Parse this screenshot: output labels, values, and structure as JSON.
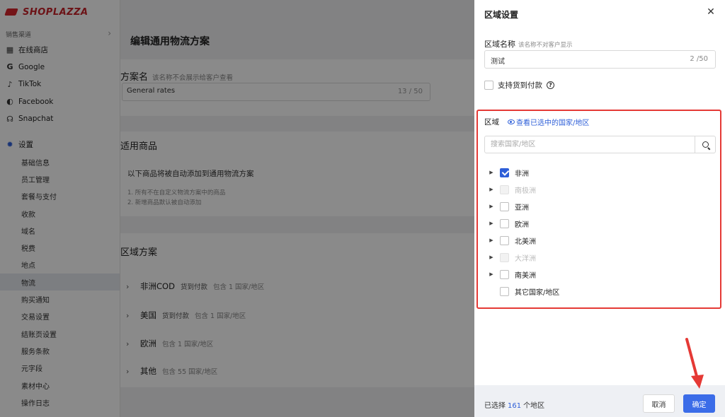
{
  "brand": {
    "logo_text": "SHOPLAZZA"
  },
  "sidebar": {
    "section_label": "销售渠道",
    "channels": [
      {
        "label": "在线商店",
        "icon": "store-icon"
      },
      {
        "label": "Google",
        "icon": "google-icon"
      },
      {
        "label": "TikTok",
        "icon": "tiktok-icon"
      },
      {
        "label": "Facebook",
        "icon": "facebook-icon"
      },
      {
        "label": "Snapchat",
        "icon": "snapchat-icon"
      }
    ],
    "settings_label": "设置",
    "settings_icon": "gear-icon",
    "settings_items": [
      "基础信息",
      "员工管理",
      "套餐与支付",
      "收款",
      "域名",
      "税费",
      "地点",
      "物流",
      "购买通知",
      "交易设置",
      "结账页设置",
      "服务条款",
      "元字段",
      "素材中心",
      "操作日志"
    ],
    "active_item": "物流"
  },
  "main": {
    "title": "编辑通用物流方案",
    "plan_name": {
      "label": "方案名",
      "hint": "该名称不会展示给客户查看",
      "value": "General rates",
      "count": "13 / 50"
    },
    "goods": {
      "title": "适用商品",
      "text": "以下商品将被自动添加到通用物流方案",
      "notes": [
        "1. 所有不在自定义物流方案中的商品",
        "2. 新增商品默认被自动添加"
      ]
    },
    "zones": {
      "title": "区域方案",
      "items": [
        {
          "name": "非洲COD",
          "tag": "货到付款",
          "info": "包含 1 国家/地区"
        },
        {
          "name": "美国",
          "tag": "货到付款",
          "info": "包含 1 国家/地区"
        },
        {
          "name": "欧洲",
          "tag": "",
          "info": "包含 1 国家/地区"
        },
        {
          "name": "其他",
          "tag": "",
          "info": "包含 55 国家/地区"
        }
      ]
    }
  },
  "drawer": {
    "title": "区域设置",
    "region_name": {
      "label": "区域名称",
      "hint": "该名称不对客户显示",
      "value": "测试",
      "count": "2 /50"
    },
    "cod": {
      "label": "支持货到付款",
      "checked": false
    },
    "area": {
      "label": "区域",
      "view_link": "查看已选中的国家/地区",
      "search_placeholder": "搜索国家/地区",
      "continents": [
        {
          "label": "非洲",
          "checked": true,
          "disabled": false
        },
        {
          "label": "南极洲",
          "checked": false,
          "disabled": true
        },
        {
          "label": "亚洲",
          "checked": false,
          "disabled": false
        },
        {
          "label": "欧洲",
          "checked": false,
          "disabled": false
        },
        {
          "label": "北美洲",
          "checked": false,
          "disabled": false
        },
        {
          "label": "大洋洲",
          "checked": false,
          "disabled": true
        },
        {
          "label": "南美洲",
          "checked": false,
          "disabled": false
        },
        {
          "label": "其它国家/地区",
          "checked": false,
          "disabled": false
        }
      ]
    },
    "footer": {
      "selected_prefix": "已选择",
      "selected_count": "161",
      "selected_suffix": "个地区",
      "cancel_label": "取消",
      "ok_label": "确定"
    },
    "colors": {
      "primary": "#3b6ce8",
      "highlight_frame": "#e53935"
    }
  }
}
